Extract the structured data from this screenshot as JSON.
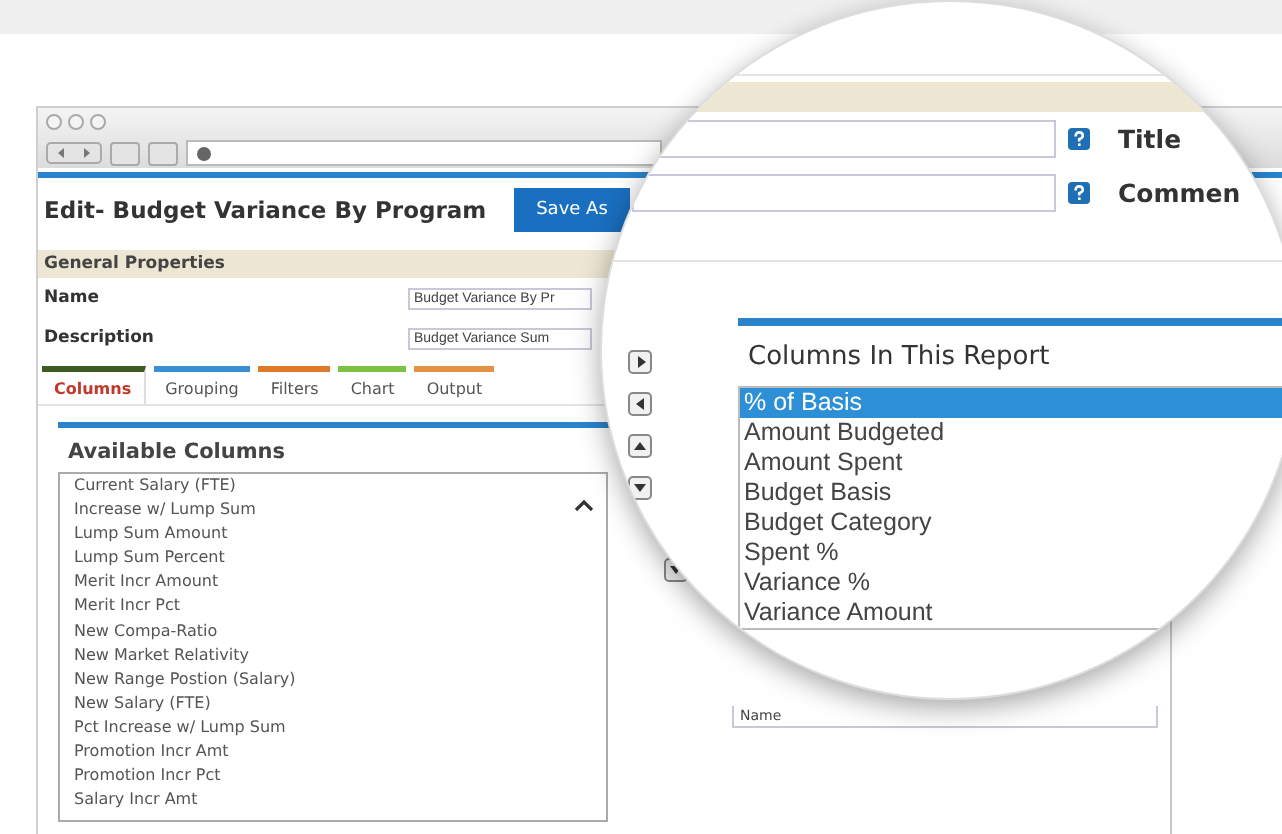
{
  "header": {
    "title": "Edit- Budget Variance By Program",
    "buttons": [
      "Save As"
    ]
  },
  "general_properties": {
    "heading": "General Properties",
    "fields": [
      {
        "label": "Name",
        "value": "Budget Variance By Pr"
      },
      {
        "label": "Description",
        "value": "Budget Variance Sum"
      }
    ]
  },
  "tabs": [
    {
      "label": "Columns",
      "selected": true,
      "color": "#3f5a22"
    },
    {
      "label": "Grouping",
      "selected": false,
      "color": "#3a8fd0"
    },
    {
      "label": "Filters",
      "selected": false,
      "color": "#e07a2a"
    },
    {
      "label": "Chart",
      "selected": false,
      "color": "#7cc243"
    },
    {
      "label": "Output",
      "selected": false,
      "color": "#e39246"
    }
  ],
  "available_columns": {
    "heading": "Available Columns",
    "items": [
      {
        "label": "Current Salary (FTE)",
        "selected": false
      },
      {
        "label": "Increase w/ Lump Sum",
        "selected": false
      },
      {
        "label": "Lump Sum Amount",
        "selected": false
      },
      {
        "label": "Lump Sum Percent",
        "selected": false
      },
      {
        "label": "Merit Incr Amount",
        "selected": false
      },
      {
        "label": "Merit Incr Pct",
        "selected": false
      },
      {
        "label": "New Compa-Ratio",
        "selected": false
      },
      {
        "label": "New Market Relativity",
        "selected": false
      },
      {
        "label": "New Range Postion (Salary)",
        "selected": false
      },
      {
        "label": "New Salary (FTE)",
        "selected": false
      },
      {
        "label": "Pct Increase w/ Lump Sum",
        "selected": false
      },
      {
        "label": "Promotion Incr Amt",
        "selected": false
      },
      {
        "label": "Promotion Incr Pct",
        "selected": false
      },
      {
        "label": "Salary Incr Amt",
        "selected": false
      }
    ]
  },
  "side_buttons": [
    {
      "kind": "down"
    }
  ],
  "report_columns_below": {
    "items": [
      "Name"
    ]
  },
  "magnifier": {
    "fields": [
      {
        "label": "Title"
      },
      {
        "label": "Commen"
      }
    ],
    "arrow_buttons": [
      {
        "kind": "right"
      },
      {
        "kind": "left"
      },
      {
        "kind": "up"
      },
      {
        "kind": "down"
      }
    ],
    "report_columns": {
      "heading": "Columns In This Report",
      "items": [
        {
          "label": "% of Basis",
          "selected": true
        },
        {
          "label": "Amount Budgeted",
          "selected": false
        },
        {
          "label": "Amount Spent",
          "selected": false
        },
        {
          "label": "Budget Basis",
          "selected": false
        },
        {
          "label": "Budget Category",
          "selected": false
        },
        {
          "label": "Spent %",
          "selected": false
        },
        {
          "label": "Variance %",
          "selected": false
        },
        {
          "label": "Variance Amount",
          "selected": false
        }
      ]
    }
  }
}
